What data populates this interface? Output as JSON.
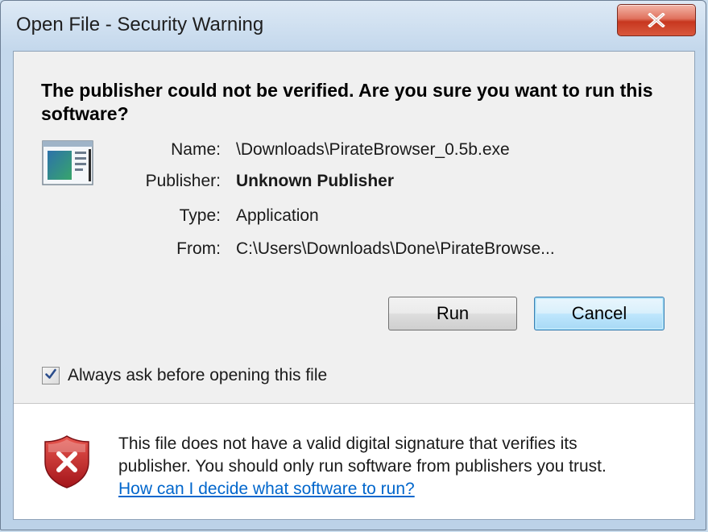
{
  "window": {
    "title": "Open File - Security Warning"
  },
  "headline": "The publisher could not be verified.  Are you sure you want to run this software?",
  "details": [
    {
      "label": "Name:",
      "value": "\\Downloads\\PirateBrowser_0.5b.exe",
      "bold": false
    },
    {
      "label": "Publisher:",
      "value": "Unknown Publisher",
      "bold": true
    },
    {
      "label": "Type:",
      "value": "Application",
      "bold": false
    },
    {
      "label": "From:",
      "value": "C:\\Users\\Downloads\\Done\\PirateBrowse...",
      "bold": false
    }
  ],
  "buttons": {
    "run": "Run",
    "cancel": "Cancel"
  },
  "checkbox": {
    "label": "Always ask before opening this file",
    "checked": true
  },
  "footer": {
    "message_line1": "This file does not have a valid digital signature that verifies its",
    "message_line2": "publisher.  You should only run software from publishers you trust.",
    "link": "How can I decide what software to run?"
  },
  "icons": {
    "close": "close-icon",
    "app": "application-icon",
    "shield": "shield-warning-icon",
    "check": "check-icon"
  },
  "colors": {
    "link": "#0066cc",
    "close_button": "#c7371f",
    "shield": "#c62828"
  }
}
